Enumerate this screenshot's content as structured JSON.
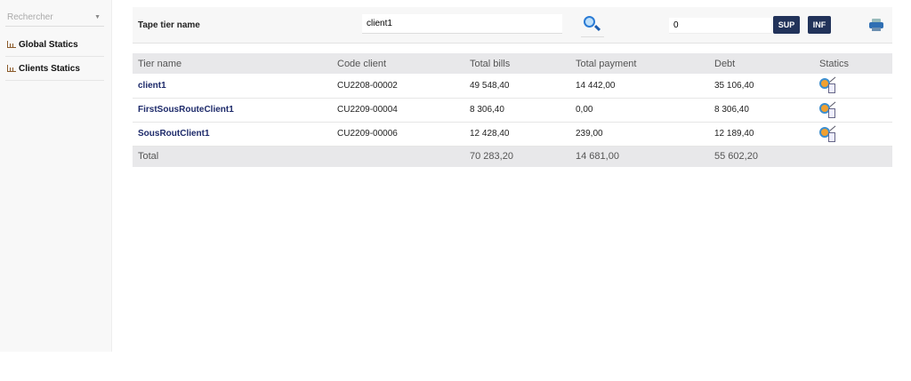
{
  "sidebar": {
    "select_placeholder": "Rechercher",
    "items": [
      {
        "label": "Global Statics",
        "icon": "bar-chart-icon"
      },
      {
        "label": "Clients Statics",
        "icon": "bar-chart-icon"
      }
    ]
  },
  "toolbar": {
    "label": "Tape tier name",
    "tier_input": "client1",
    "number_input": "0",
    "sup_label": "SUP",
    "inf_label": "INF"
  },
  "table": {
    "headers": [
      "Tier name",
      "Code client",
      "Total bills",
      "Total payment",
      "Debt",
      "Statics"
    ],
    "rows": [
      {
        "name": "client1",
        "code": "CU2208-00002",
        "bills": "49 548,40",
        "payment": "14 442,00",
        "debt": "35 106,40"
      },
      {
        "name": "FirstSousRouteClient1",
        "code": "CU2209-00004",
        "bills": "8 306,40",
        "payment": "0,00",
        "debt": "8 306,40"
      },
      {
        "name": "SousRoutClient1",
        "code": "CU2209-00006",
        "bills": "12 428,40",
        "payment": "239,00",
        "debt": "12 189,40"
      }
    ],
    "total": {
      "label": "Total",
      "bills": "70 283,20",
      "payment": "14 681,00",
      "debt": "55 602,20"
    }
  },
  "colors": {
    "button": "#22335a",
    "name": "#1d2a6a",
    "header_bg": "#e8e8ea"
  }
}
